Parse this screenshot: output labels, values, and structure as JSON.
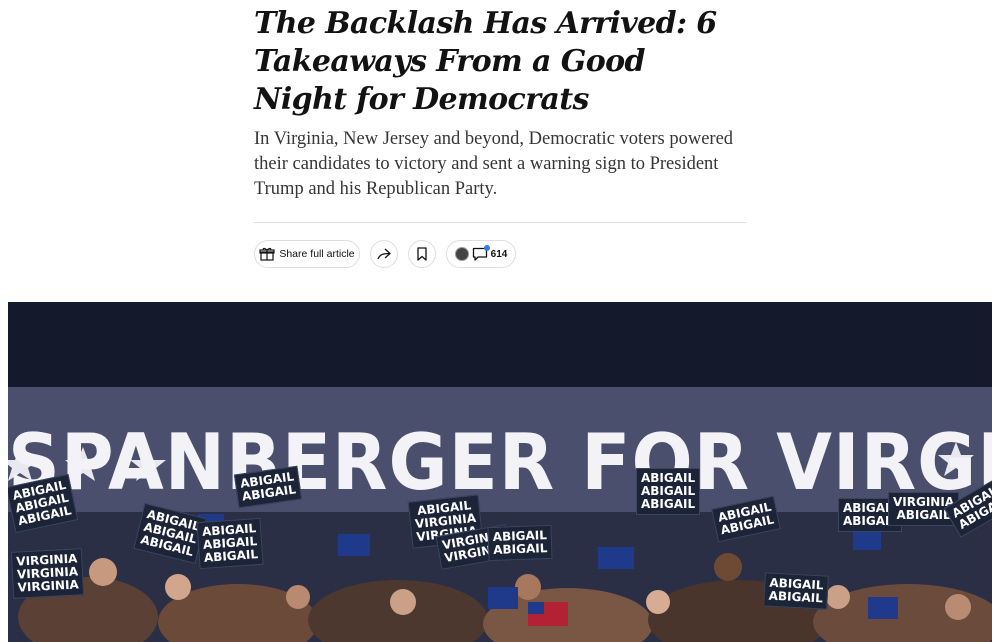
{
  "article": {
    "headline": "The Backlash Has Arrived: 6 Takeaways From a Good Night for Democrats",
    "summary": "In Virginia, New Jersey and beyond, Democratic voters powered their candidates to victory and sent a warning sign to President Trump and his Republican Party."
  },
  "share_bar": {
    "share_full_label": "Share full article",
    "comment_count": "614",
    "icons": [
      "gift-icon",
      "share-arrow-icon",
      "bookmark-icon",
      "comment-icon"
    ]
  },
  "photo": {
    "banner_text": "SPANBERGER FOR VIRGINIA",
    "sign_name": "ABIGAIL",
    "sign_state": "VIRGINIA"
  },
  "colors": {
    "banner_background": "#4a4f6e",
    "flag_blue": "#1f3a8a",
    "star_white": "#e8e8ee"
  }
}
